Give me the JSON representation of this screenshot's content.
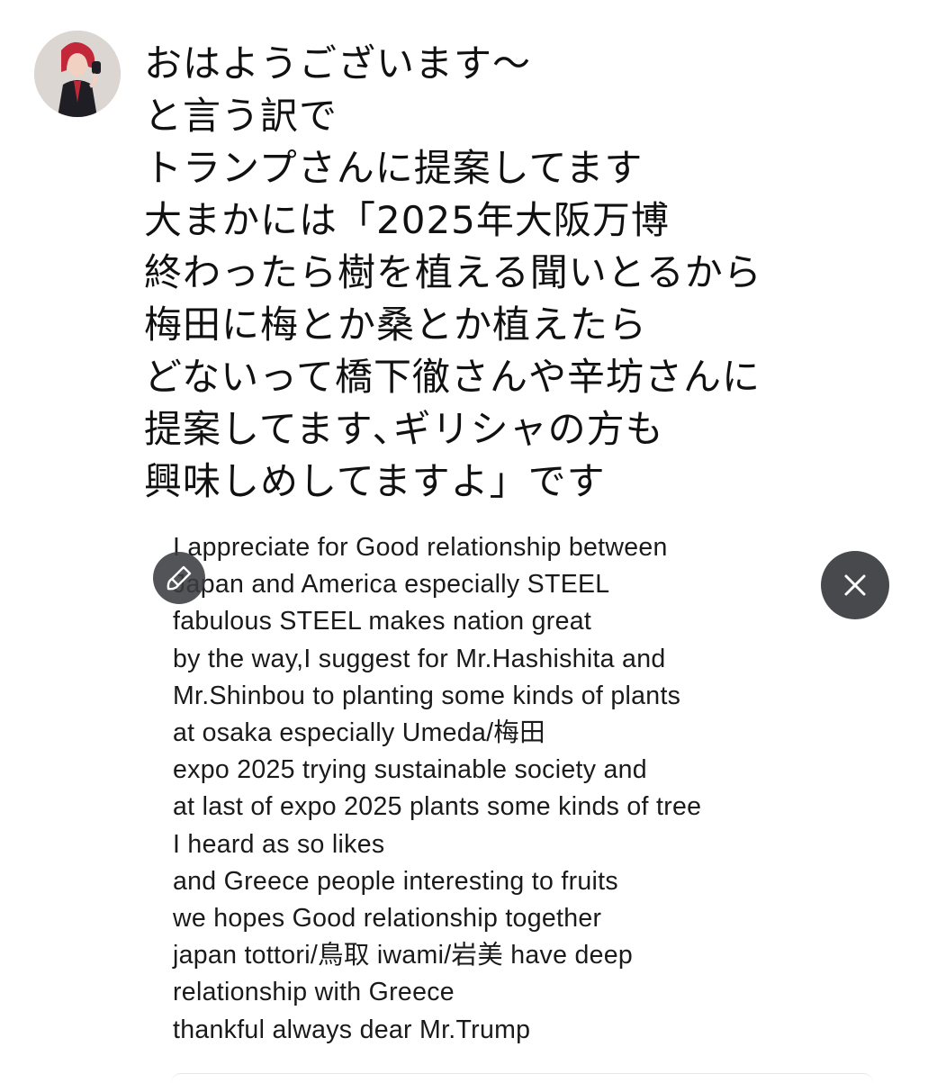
{
  "post": {
    "author_avatar": "avatar-illustration",
    "text_lines": [
      "おはようございます〜",
      "と言う訳で",
      "トランプさんに提案してます",
      "大まかには「2025年大阪万博",
      "終わったら樹を植える聞いとるから",
      "梅田に梅とか桑とか植えたら",
      "どないって橋下徹さんや辛坊さんに",
      "提案してます､ギリシャの方も",
      "興味しめしてますよ」です"
    ]
  },
  "attached_image": {
    "text_lines": [
      "I appreciate for Good relationship between",
      "Japan and America especially STEEL",
      "fabulous STEEL makes nation great",
      "by the way,I suggest for Mr.Hashishita and",
      "Mr.Shinbou to planting some kinds of plants",
      "at osaka especially Umeda/梅田",
      "expo 2025 trying sustainable society and",
      "at last of expo 2025 plants some kinds of tree",
      "I heard as so likes",
      "and Greece people interesting to fruits",
      "we hopes Good relationship together",
      "japan tottori/鳥取 iwami/岩美 have deep",
      "relationship with Greece",
      "thankful always dear Mr.Trump"
    ]
  },
  "controls": {
    "edit_icon": "brush-icon",
    "close_icon": "close-icon",
    "colors": {
      "edit_bg": "#3a3c40",
      "close_bg": "#48494d",
      "icon": "#ffffff"
    }
  }
}
